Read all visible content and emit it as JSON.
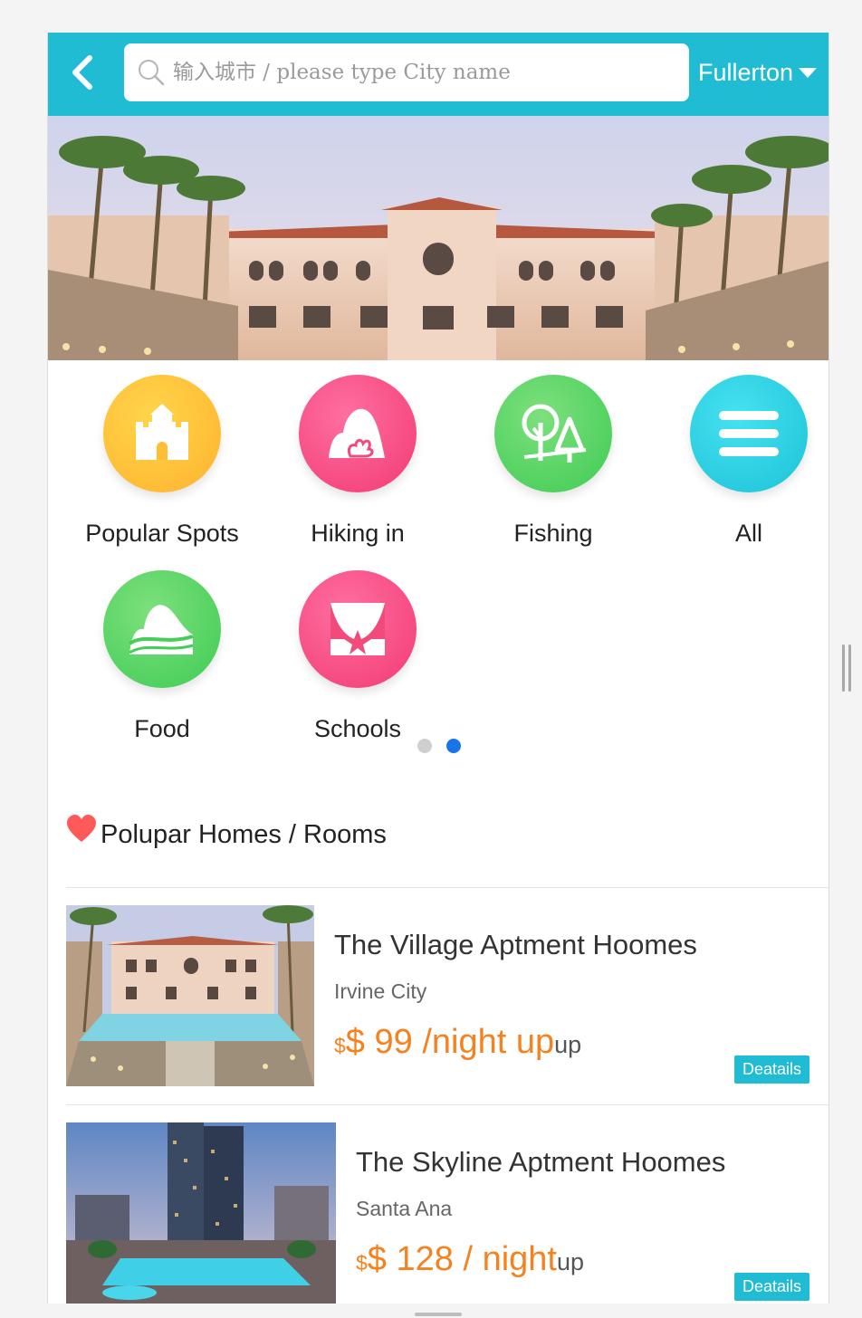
{
  "header": {
    "search_placeholder": "输入城市 / please type City name",
    "city": "Fullerton"
  },
  "colors": {
    "header_bg": "#1fbcd3",
    "price": "#f5821f",
    "details_bg": "#1fbcd3",
    "dot_active": "#1a73e8"
  },
  "banner": {
    "image": "resort-apartment-courtyard-photo"
  },
  "categories": [
    {
      "label": "Popular Spots",
      "icon": "castle-icon",
      "color": "#ffc234"
    },
    {
      "label": "Hiking in",
      "icon": "mountain-icon",
      "color": "#f54a80"
    },
    {
      "label": "Fishing",
      "icon": "trees-icon",
      "color": "#4dd35f"
    },
    {
      "label": "All",
      "icon": "menu-icon",
      "color": "#27cde0"
    },
    {
      "label": "Food",
      "icon": "hills-icon",
      "color": "#4dd35f"
    },
    {
      "label": "Schools",
      "icon": "theater-icon",
      "color": "#f54a80"
    }
  ],
  "pager": {
    "pages": 2,
    "active": 2
  },
  "section": {
    "title": "Polupar Homes / Rooms"
  },
  "listings": [
    {
      "title": "The Village Aptment Hoomes",
      "city": "Irvine City",
      "currency": "$",
      "price": "$ 99 /night up",
      "suffix": "up",
      "details": "Deatails"
    },
    {
      "title": "The Skyline Aptment Hoomes",
      "city": "Santa Ana",
      "currency": "$",
      "price": "$ 128 / night",
      "suffix": "up",
      "details": "Deatails"
    }
  ]
}
